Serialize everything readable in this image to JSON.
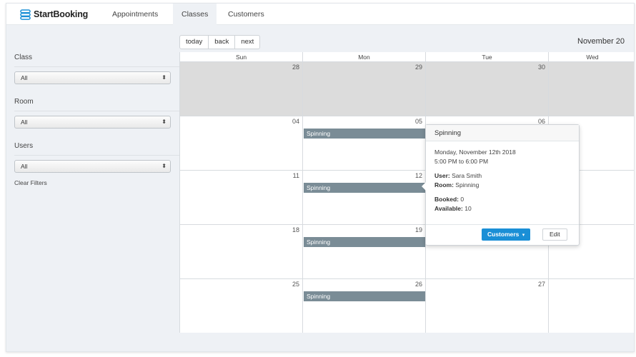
{
  "brand": {
    "name": "StartBooking",
    "logo_icon": "startbooking-logo-icon",
    "logo_color": "#1a8fd6"
  },
  "nav": {
    "tabs": [
      {
        "label": "Appointments"
      },
      {
        "label": "Classes",
        "active": true
      },
      {
        "label": "Customers"
      }
    ]
  },
  "filters": {
    "class": {
      "label": "Class",
      "value": "All"
    },
    "room": {
      "label": "Room",
      "value": "All"
    },
    "users": {
      "label": "Users",
      "value": "All"
    },
    "clear_label": "Clear Filters"
  },
  "toolbar": {
    "today": "today",
    "back": "back",
    "next": "next",
    "title": "November 20"
  },
  "calendar": {
    "day_headers": [
      "Sun",
      "Mon",
      "Tue",
      "Wed"
    ],
    "weeks": [
      {
        "days": [
          "28",
          "29",
          "30",
          ""
        ],
        "other_month": true,
        "event": ""
      },
      {
        "days": [
          "04",
          "05",
          "06",
          ""
        ],
        "other_month": false,
        "event": "Spinning"
      },
      {
        "days": [
          "11",
          "12",
          "",
          ""
        ],
        "other_month": false,
        "event": "Spinning"
      },
      {
        "days": [
          "18",
          "19",
          "",
          ""
        ],
        "other_month": false,
        "event": "Spinning"
      },
      {
        "days": [
          "25",
          "26",
          "27",
          ""
        ],
        "other_month": false,
        "event": "Spinning"
      }
    ],
    "event_color": "#7a8c96",
    "other_month_color": "#dcdcdc"
  },
  "popover": {
    "title": "Spinning",
    "date": "Monday, November 12th 2018",
    "time": "5:00 PM to 6:00 PM",
    "user_label": "User:",
    "user_value": "Sara Smith",
    "room_label": "Room:",
    "room_value": "Spinning",
    "booked_label": "Booked:",
    "booked_value": "0",
    "available_label": "Available:",
    "available_value": "10",
    "customers_button": "Customers",
    "edit_button": "Edit",
    "accent": "#1a8fd6"
  }
}
